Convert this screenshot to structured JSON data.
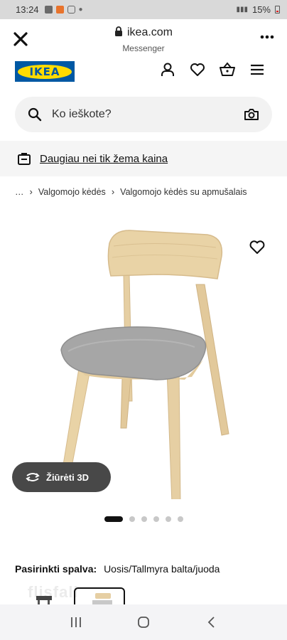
{
  "status_bar": {
    "time": "13:24",
    "battery_text": "15%"
  },
  "browser": {
    "url": "ikea.com",
    "subtitle": "Messenger"
  },
  "brand": {
    "logo_text": "IKEA",
    "blue": "#0058a3",
    "yellow": "#ffdb00"
  },
  "header": {
    "icons": [
      "user-icon",
      "heart-icon",
      "basket-icon",
      "menu-icon"
    ]
  },
  "search": {
    "placeholder": "Ko ieškote?"
  },
  "promo": {
    "text": "Daugiau nei tik žema kaina"
  },
  "breadcrumb": {
    "ellipsis": "…",
    "items": [
      "Valgomojo kėdės",
      "Valgomojo kėdės su apmušalais"
    ]
  },
  "product": {
    "view_3d_label": "Žiūrėti 3D",
    "gallery_count": 6,
    "gallery_active": 0
  },
  "color": {
    "label": "Pasirinkti spalva:",
    "value": "Uosis/Tallmyra balta/juoda"
  },
  "thumb_ghost": "flisfall"
}
